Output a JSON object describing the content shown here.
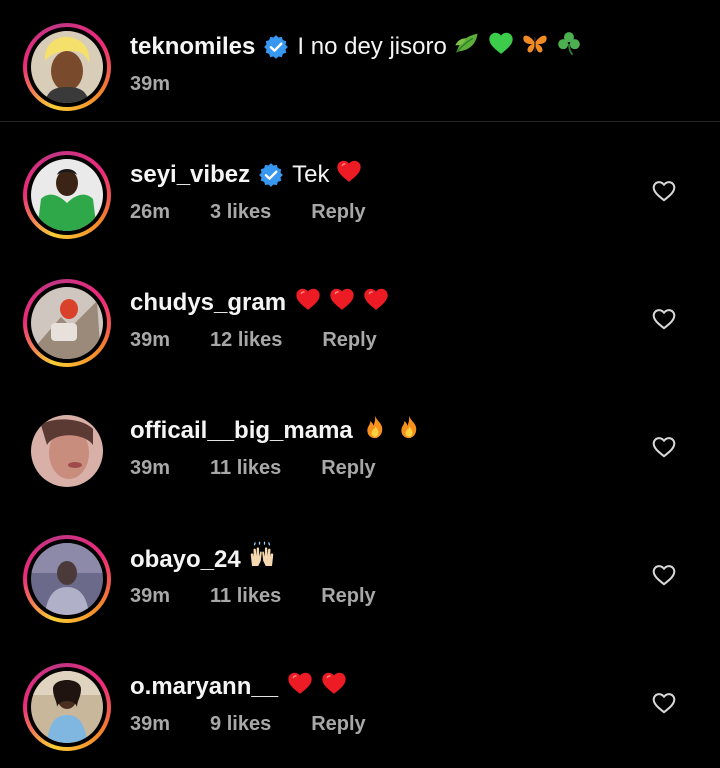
{
  "caption": {
    "username": "teknomiles",
    "verified": true,
    "text": "I no dey jisoro",
    "time": "39m"
  },
  "comments": [
    {
      "username": "seyi_vibez",
      "verified": true,
      "text": "Tek",
      "time": "26m",
      "likes": "3 likes",
      "reply": "Reply"
    },
    {
      "username": "chudys_gram",
      "verified": false,
      "text": "",
      "time": "39m",
      "likes": "12 likes",
      "reply": "Reply"
    },
    {
      "username": "officail__big_mama",
      "verified": false,
      "text": "",
      "time": "39m",
      "likes": "11 likes",
      "reply": "Reply"
    },
    {
      "username": "obayo_24",
      "verified": false,
      "text": "",
      "time": "39m",
      "likes": "11 likes",
      "reply": "Reply"
    },
    {
      "username": "o.maryann__",
      "verified": false,
      "text": "",
      "time": "39m",
      "likes": "9 likes",
      "reply": "Reply"
    }
  ],
  "icons": {
    "verified_color": "#3897f0",
    "heart_color": "#ed1c24",
    "background": "#000000",
    "muted_text": "#a8a8a8"
  }
}
